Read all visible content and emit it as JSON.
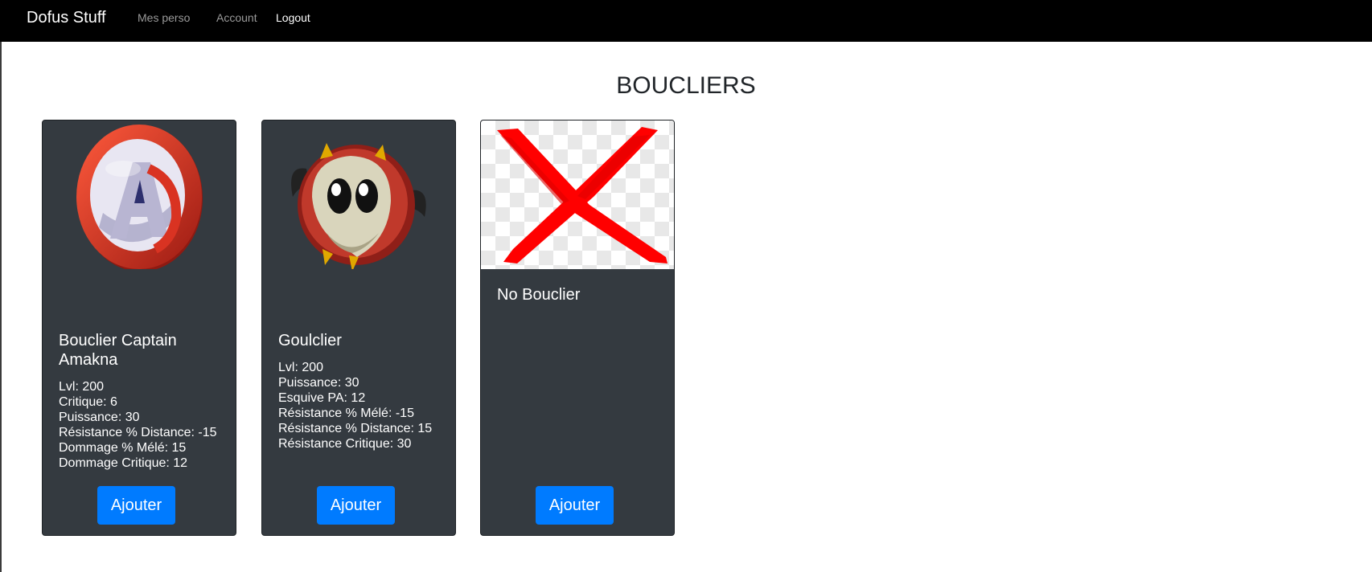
{
  "navbar": {
    "brand": "Dofus Stuff",
    "links": [
      {
        "label": "Mes perso"
      },
      {
        "label": "Account"
      },
      {
        "label": "Logout"
      }
    ]
  },
  "page": {
    "title": "BOUCLIERS"
  },
  "cards": [
    {
      "title": "Bouclier Captain Amakna",
      "image_icon": "captain-shield-icon",
      "stats": [
        "Lvl: 200",
        "Critique: 6",
        "Puissance: 30",
        "Résistance % Distance: -15",
        "Dommage % Mélé: 15",
        "Dommage Critique: 12"
      ],
      "button": "Ajouter"
    },
    {
      "title": "Goulclier",
      "image_icon": "goulclier-shield-icon",
      "stats": [
        "Lvl: 200",
        "Puissance: 30",
        "Esquive PA: 12",
        "Résistance % Mélé: -15",
        "Résistance % Distance: 15",
        "Résistance Critique: 30"
      ],
      "button": "Ajouter"
    },
    {
      "title": "No Bouclier",
      "image_icon": "red-cross-icon",
      "stats": [],
      "button": "Ajouter"
    }
  ],
  "colors": {
    "navbar": "#000000",
    "card": "#343a40",
    "button": "#007bff",
    "title": "#212529"
  }
}
